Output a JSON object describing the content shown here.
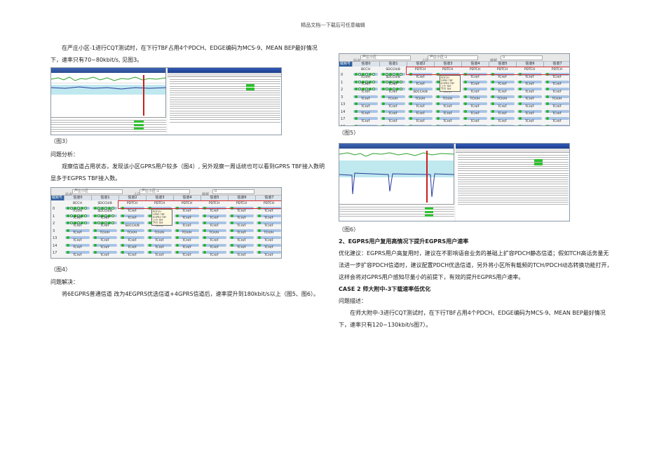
{
  "header": "精品文档---下载后可任意编辑",
  "left": {
    "p1": "在严庄小区-1进行CQT测试时，在下行TBF占用4个PDCH、EDGE编码为MCS-9、MEAN BEP最好情况下，速率只有70~80kbit/s, 见图3。",
    "fig3_caption": "（图3）",
    "analysis_title": "问题分析：",
    "p2": "观察信道占用状态，发现该小区GPRS用户较多（图4）, 另外观察一周话统也可以看到GPRS TBF接入数明显多于EGPRS TBF接入数。",
    "fig4_caption": "（图4）",
    "solution_title": "问题解决：",
    "p3": "将6EGPRS普通信道 改为4EGPRS优选信道+4GPRS信道后，速率提升到180kbit/s以上（图5、图6）。"
  },
  "right": {
    "fig5_caption": "（图5）",
    "fig6_caption": "（图6）",
    "h2": "2、EGPRS用户复用高情况下提升EGPRS用户速率",
    "p4": "优化建议：EGPRS用户高复用时，建议在不影响语音业务的基础上扩容PDCH静态信道；假如TCH高话务量无法进一步扩容PDCH信道时，建议配置PDCH优选信道，另外将小区所有载频的TCH/PDCH动态转换功能打开，这样会将对GPRS用户感知尽量小的前提下，有效的提升EGPRS用户速率。",
    "case2": "CASE 2 师大附中-3下载速率低优化",
    "desc_title": "问题描述：",
    "p5": "在师大附中-3进行CQT测试时，在下行TBF占用4个PDCH、EDGE编码为MCS-9、MEAN BEP最好情况下，速率只有120~130kbit/s图7）。"
  },
  "grid": {
    "toolbar": [
      "站点",
      "严庄小区",
      "小区",
      "严庄小区-1",
      "载频",
      "0"
    ],
    "headers": [
      "载频号",
      "信道0",
      "信道1",
      "信道2",
      "信道3",
      "信道4",
      "信道5",
      "信道6",
      "信道7"
    ],
    "row_nums": [
      "0",
      "1",
      "2",
      "3",
      "13",
      "14",
      "17",
      "18"
    ],
    "rows": [
      [
        "BCCH",
        "SDCCH/8",
        "PDTCH",
        "PDTCH",
        "PDTCH",
        "PDTCH",
        "PDTCH",
        "PDTCH"
      ],
      [
        "TCH/H",
        "SDCCH/8",
        "TCH/F",
        "TCH/F",
        "TCH/F",
        "TCH/F",
        "TCH/F",
        "TCH/F"
      ],
      [
        "TCH/F",
        "TCH/F",
        "TCH/F",
        "SDCCH/8",
        "TCH/F",
        "TCH/F",
        "TCH/F",
        "TCH/F"
      ],
      [
        "TCH/F",
        "TCH/F",
        "SDCCH/8",
        "TCH/F",
        "TCH/F",
        "TCH/F",
        "TCH/F",
        "TCH/F"
      ],
      [
        "TCH/F",
        "TCH/H",
        "TCH/H",
        "TCH/H",
        "TCH/H",
        "TCH/H",
        "TCH/F",
        "TCH/H"
      ],
      [
        "TCH/F",
        "TCH/F",
        "TCH/F",
        "TCH/F",
        "TCH/F",
        "TCH/F",
        "TCH/F",
        "TCH/F"
      ],
      [
        "TCH/F",
        "TCH/F",
        "TCH/F",
        "TCH/F",
        "TCH/F",
        "TCH/F",
        "TCH/F",
        "TCH/F"
      ],
      [
        "TCH/F",
        "TCH/F",
        "TCH/F",
        "TCH/F",
        "TCH/F",
        "TCH/F",
        "TCH/F",
        "TCH/F"
      ]
    ],
    "popup_lines": [
      "PDTCH",
      "GPRS TBF",
      "EGPRS TBF",
      "上行 TBF",
      "下行 TBF"
    ]
  },
  "colors": {
    "accent_red": "#c81e1e",
    "dot_green": "#24b424",
    "track_blue": "#a8c4e6",
    "title_blue": "#2a4c92"
  }
}
